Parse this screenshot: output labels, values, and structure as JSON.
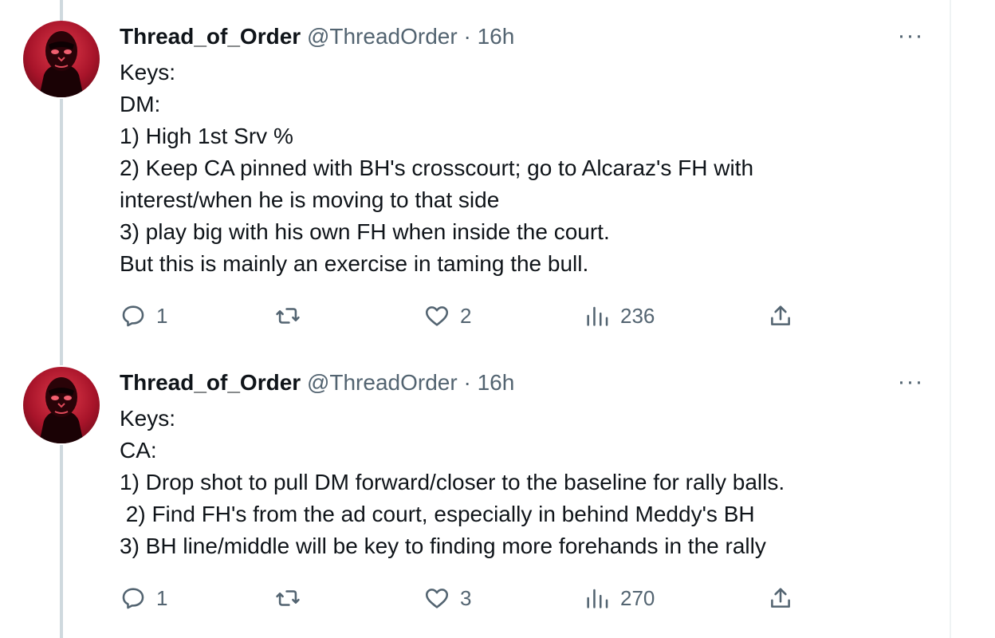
{
  "tweets": [
    {
      "author": {
        "name": "Thread_of_Order",
        "handle": "@ThreadOrder"
      },
      "separator": "·",
      "time": "16h",
      "more_label": "···",
      "lines": [
        "Keys:",
        "DM:",
        "1) High 1st Srv %",
        "2) Keep CA pinned with BH's crosscourt; go to Alcaraz's FH with",
        "interest/when he is moving to that side",
        "3) play big with his own FH when inside the court.",
        "But this is mainly an exercise in taming the bull."
      ],
      "stats": {
        "replies": "1",
        "reposts": "",
        "likes": "2",
        "views": "236"
      }
    },
    {
      "author": {
        "name": "Thread_of_Order",
        "handle": "@ThreadOrder"
      },
      "separator": "·",
      "time": "16h",
      "more_label": "···",
      "lines": [
        "Keys:",
        "CA:",
        "1) Drop shot to pull DM forward/closer to the baseline for rally balls.",
        " 2) Find FH's from the ad court, especially in behind Meddy's BH",
        "3) BH line/middle will be key to finding more forehands in the rally"
      ],
      "stats": {
        "replies": "1",
        "reposts": "",
        "likes": "3",
        "views": "270"
      }
    }
  ],
  "icons": {
    "reply": "reply-icon",
    "repost": "repost-icon",
    "like": "heart-icon",
    "views": "views-icon",
    "share": "share-icon"
  },
  "colors": {
    "text": "#0f1419",
    "secondary": "#536471",
    "thread_line": "#cfd9de",
    "avatar_red": "#c0182e"
  }
}
